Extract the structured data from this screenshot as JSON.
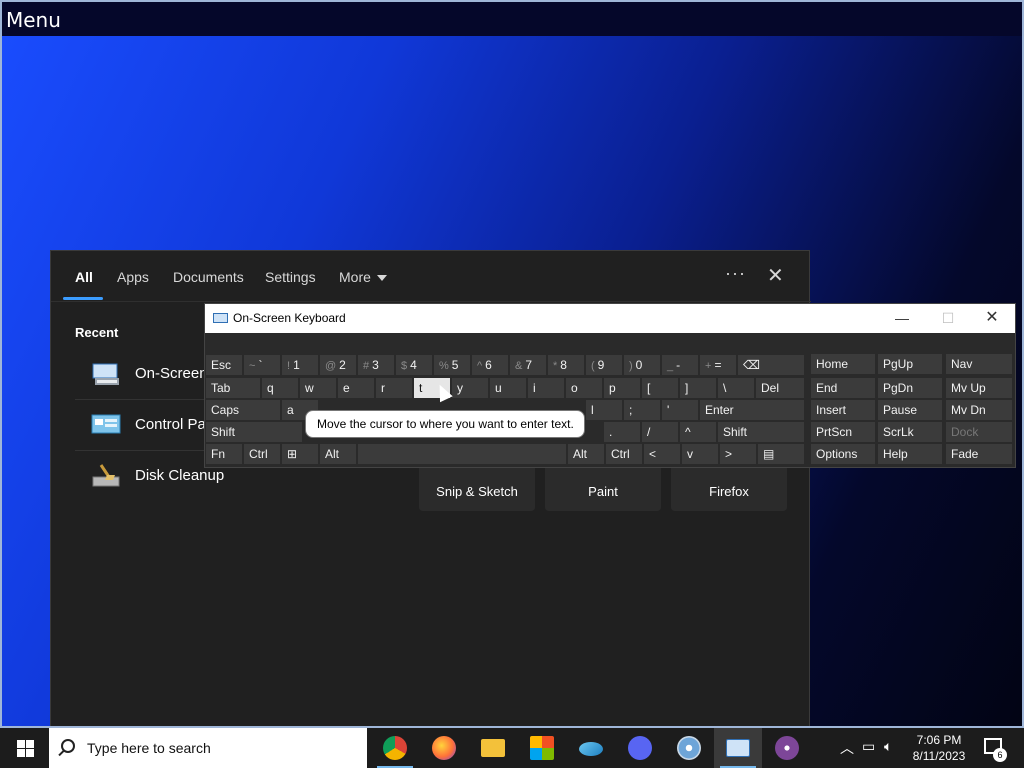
{
  "desktop": {
    "menu_label": "Menu"
  },
  "search_panel": {
    "tabs": [
      "All",
      "Apps",
      "Documents",
      "Settings",
      "More"
    ],
    "ellipsis": "···",
    "close": "✕",
    "recent_heading": "Recent",
    "recent_items": [
      "On-Screen",
      "Control Pan",
      "Disk Cleanup"
    ],
    "tiles": [
      "Snip & Sketch",
      "Paint",
      "Firefox"
    ]
  },
  "osk": {
    "title": "On-Screen Keyboard",
    "tooltip": "Move the cursor to where you want to enter text.",
    "min": "—",
    "max": "☐",
    "close": "✕",
    "rows": {
      "r1": [
        [
          "Esc",
          ""
        ],
        [
          "`",
          "~"
        ],
        [
          "1",
          "!"
        ],
        [
          "2",
          "@"
        ],
        [
          "3",
          "#"
        ],
        [
          "4",
          "$"
        ],
        [
          "5",
          "%"
        ],
        [
          "6",
          "^"
        ],
        [
          "7",
          "&"
        ],
        [
          "8",
          "*"
        ],
        [
          "9",
          "("
        ],
        [
          "0",
          ")"
        ],
        [
          "-",
          "_"
        ],
        [
          "=",
          "+"
        ],
        [
          "⌫",
          ""
        ]
      ],
      "r2": [
        "Tab",
        "q",
        "w",
        "e",
        "r",
        "t",
        "y",
        "u",
        "i",
        "o",
        "p",
        "[",
        "]",
        "\\",
        "Del"
      ],
      "r3": [
        "Caps",
        "a",
        "l",
        ";",
        "'",
        "Enter"
      ],
      "r4": [
        "Shift",
        ".",
        "/",
        "^",
        "Shift"
      ],
      "r5": [
        "Fn",
        "Ctrl",
        "⊞",
        "Alt",
        "Alt",
        "Ctrl",
        "<",
        "v",
        ">",
        "▤"
      ]
    },
    "nav": [
      [
        "Home",
        "PgUp",
        "Nav"
      ],
      [
        "End",
        "PgDn",
        "Mv Up"
      ],
      [
        "Insert",
        "Pause",
        "Mv Dn"
      ],
      [
        "PrtScn",
        "ScrLk",
        "Dock"
      ],
      [
        "Options",
        "Help",
        "Fade"
      ]
    ]
  },
  "taskbar": {
    "search_placeholder": "Type here to search",
    "time": "7:06 PM",
    "date": "8/11/2023",
    "notification_count": "6"
  }
}
